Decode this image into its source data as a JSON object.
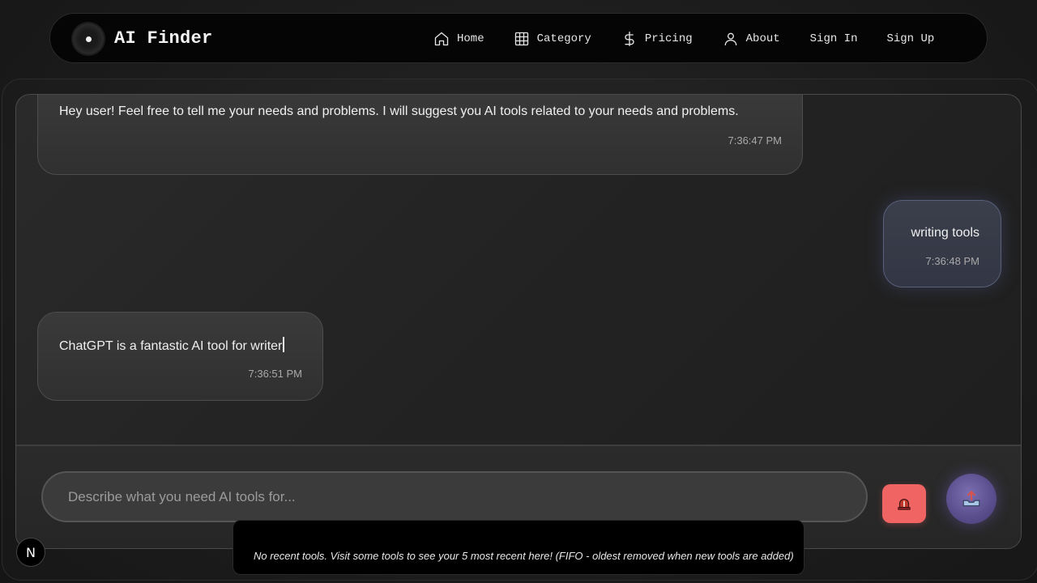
{
  "brand": {
    "name": "AI Finder"
  },
  "nav": {
    "home": "Home",
    "category": "Category",
    "pricing": "Pricing",
    "about": "About",
    "sign_in": "Sign In",
    "sign_up": "Sign Up"
  },
  "messages": [
    {
      "role": "bot",
      "text": "Hey user! Feel free to tell me your needs and problems. I will suggest you AI tools related to your needs and problems.",
      "time": "7:36:47 PM"
    },
    {
      "role": "user",
      "text": "writing tools",
      "time": "7:36:48 PM"
    },
    {
      "role": "bot",
      "text": "ChatGPT is a fantastic AI tool for writer",
      "time": "7:36:51 PM"
    }
  ],
  "input": {
    "placeholder": "Describe what you need AI tools for..."
  },
  "recent": {
    "text": "No recent tools. Visit some tools to see your 5 most recent here! (FIFO - oldest removed when new tools are added)"
  },
  "badge": {
    "letter": "N"
  },
  "icons": {
    "alert": "siren-icon",
    "send": "upload-tray-icon"
  },
  "colors": {
    "alert_button": "#f06464",
    "send_button": "#5a4d8c",
    "user_bubble_border": "#58607a"
  }
}
